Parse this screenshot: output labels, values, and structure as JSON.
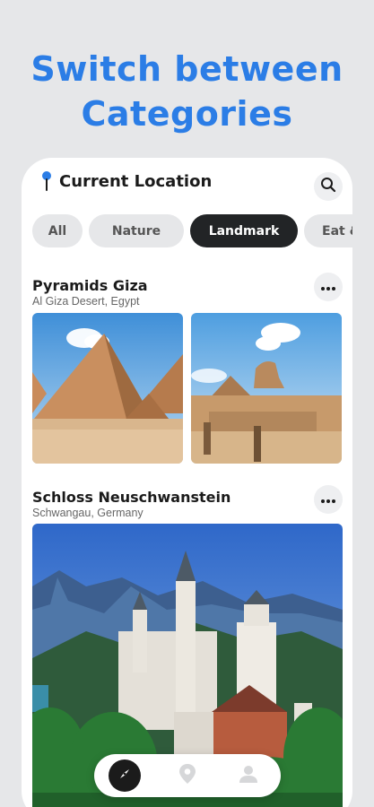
{
  "headline": {
    "line1": "Switch between",
    "line2": "Categories"
  },
  "header": {
    "title": "Current Location"
  },
  "categories": [
    {
      "label": "All"
    },
    {
      "label": "Nature"
    },
    {
      "label": "Landmark",
      "selected": true
    },
    {
      "label": "Eat & Drink"
    }
  ],
  "posts": [
    {
      "title": "Pyramids Giza",
      "location": "Al Giza Desert, Egypt"
    },
    {
      "title": "Schloss Neuschwanstein",
      "location": "Schwangau, Germany"
    }
  ],
  "icons": {
    "location": "location-pin-icon",
    "search": "search-icon",
    "more": "more-horizontal-icon",
    "nav": [
      "compass-icon",
      "map-pin-icon",
      "profile-icon"
    ]
  },
  "colors": {
    "accent": "#2b7de6",
    "chip_active": "#222426",
    "chip_inactive": "#e6e7e9"
  }
}
